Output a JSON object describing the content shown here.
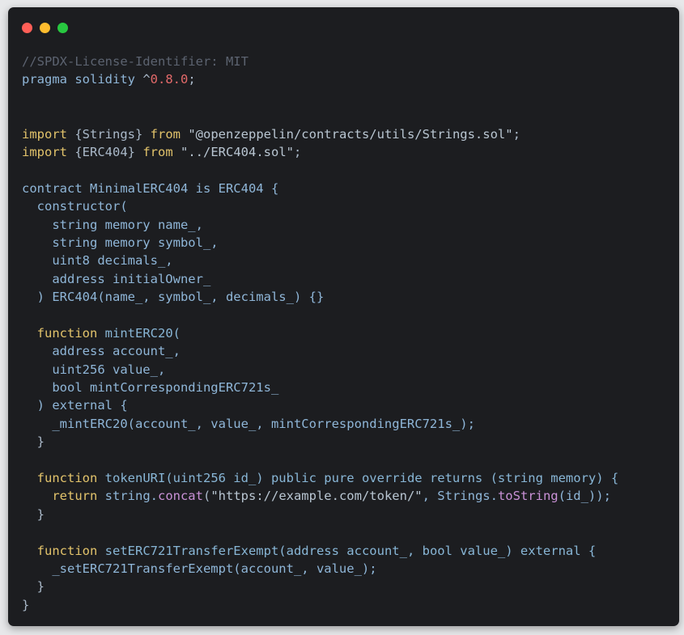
{
  "window": {
    "buttons": [
      "close",
      "minimize",
      "maximize"
    ],
    "colors": {
      "close": "#ff5f57",
      "minimize": "#febc2e",
      "maximize": "#28c840",
      "background": "#1c1d20"
    }
  },
  "code": {
    "language": "solidity",
    "lines": [
      [
        {
          "t": "//SPDX-License-Identifier: MIT",
          "c": "comment"
        }
      ],
      [
        {
          "t": "pragma solidity ",
          "c": "type"
        },
        {
          "t": "^",
          "c": "op"
        },
        {
          "t": "0.8.0",
          "c": "num"
        },
        {
          "t": ";",
          "c": "plain"
        }
      ],
      [],
      [],
      [
        {
          "t": "import ",
          "c": "kw"
        },
        {
          "t": "{Strings} ",
          "c": "plain"
        },
        {
          "t": "from ",
          "c": "kw"
        },
        {
          "t": "\"@openzeppelin/contracts/utils/Strings.sol\"",
          "c": "str"
        },
        {
          "t": ";",
          "c": "plain"
        }
      ],
      [
        {
          "t": "import ",
          "c": "kw"
        },
        {
          "t": "{ERC404} ",
          "c": "plain"
        },
        {
          "t": "from ",
          "c": "kw"
        },
        {
          "t": "\"../ERC404.sol\"",
          "c": "str"
        },
        {
          "t": ";",
          "c": "plain"
        }
      ],
      [],
      [
        {
          "t": "contract MinimalERC404 is ERC404 {",
          "c": "type"
        }
      ],
      [
        {
          "t": "  constructor(",
          "c": "type"
        }
      ],
      [
        {
          "t": "    string memory name_,",
          "c": "type"
        }
      ],
      [
        {
          "t": "    string memory symbol_,",
          "c": "type"
        }
      ],
      [
        {
          "t": "    uint8 decimals_,",
          "c": "type"
        }
      ],
      [
        {
          "t": "    address initialOwner_",
          "c": "type"
        }
      ],
      [
        {
          "t": "  ) ERC404(name_, symbol_, decimals_) {}",
          "c": "type"
        }
      ],
      [],
      [
        {
          "t": "  ",
          "c": "plain"
        },
        {
          "t": "function ",
          "c": "kw"
        },
        {
          "t": "mintERC20(",
          "c": "fn"
        }
      ],
      [
        {
          "t": "    address account_,",
          "c": "type"
        }
      ],
      [
        {
          "t": "    uint256 value_,",
          "c": "type"
        }
      ],
      [
        {
          "t": "    bool mintCorrespondingERC721s_",
          "c": "type"
        }
      ],
      [
        {
          "t": "  ) external {",
          "c": "type"
        }
      ],
      [
        {
          "t": "    _mintERC20(account_, value_, mintCorrespondingERC721s_);",
          "c": "type"
        }
      ],
      [
        {
          "t": "  }",
          "c": "plain"
        }
      ],
      [],
      [
        {
          "t": "  ",
          "c": "plain"
        },
        {
          "t": "function ",
          "c": "kw"
        },
        {
          "t": "tokenURI(uint256 id_) public pure override returns (string memory) {",
          "c": "fn"
        }
      ],
      [
        {
          "t": "    ",
          "c": "plain"
        },
        {
          "t": "return ",
          "c": "kw"
        },
        {
          "t": "string.",
          "c": "type"
        },
        {
          "t": "concat",
          "c": "method"
        },
        {
          "t": "(",
          "c": "plain"
        },
        {
          "t": "\"https://example.com/token/\"",
          "c": "str"
        },
        {
          "t": ", Strings.",
          "c": "type"
        },
        {
          "t": "toString",
          "c": "method"
        },
        {
          "t": "(id_));",
          "c": "type"
        }
      ],
      [
        {
          "t": "  }",
          "c": "plain"
        }
      ],
      [],
      [
        {
          "t": "  ",
          "c": "plain"
        },
        {
          "t": "function ",
          "c": "kw"
        },
        {
          "t": "setERC721TransferExempt(address account_, bool value_) external {",
          "c": "fn"
        }
      ],
      [
        {
          "t": "    _setERC721TransferExempt(account_, value_);",
          "c": "type"
        }
      ],
      [
        {
          "t": "  }",
          "c": "plain"
        }
      ],
      [
        {
          "t": "}",
          "c": "plain"
        }
      ]
    ]
  }
}
